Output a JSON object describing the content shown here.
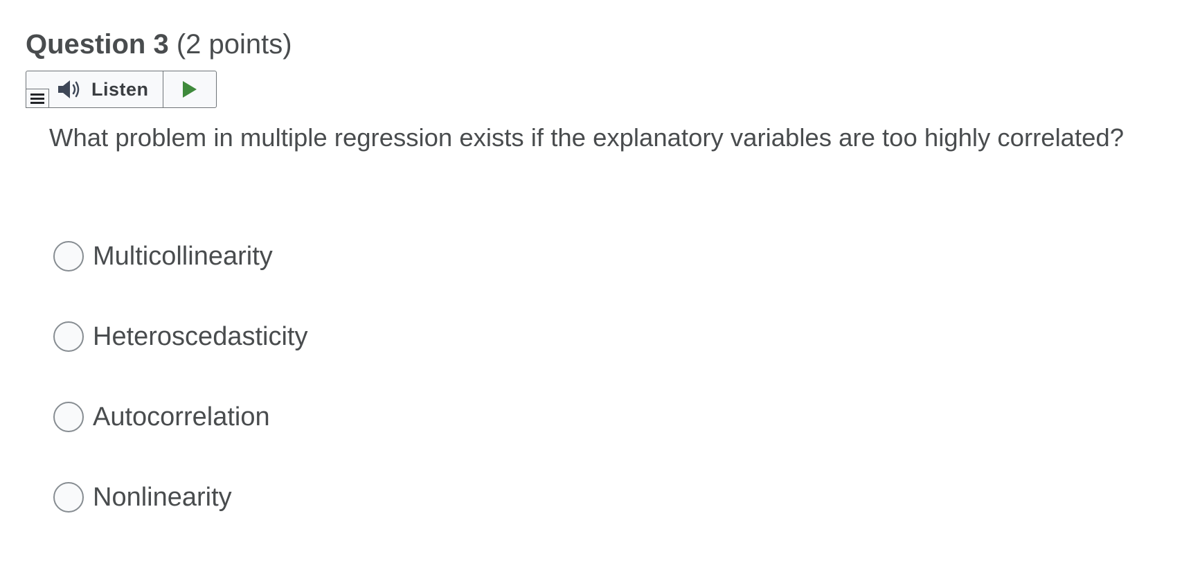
{
  "question": {
    "title": "Question 3",
    "points": "(2 points)",
    "text": "What problem in multiple regression exists if the explanatory variables are too highly correlated?"
  },
  "listen": {
    "label": "Listen",
    "icon": "speaker-icon",
    "play_icon": "play-icon",
    "menu_icon": "menu-icon",
    "play_color": "#3f8a3c"
  },
  "options": [
    {
      "label": "Multicollinearity",
      "selected": false
    },
    {
      "label": "Heteroscedasticity",
      "selected": false
    },
    {
      "label": "Autocorrelation",
      "selected": false
    },
    {
      "label": "Nonlinearity",
      "selected": false
    }
  ]
}
